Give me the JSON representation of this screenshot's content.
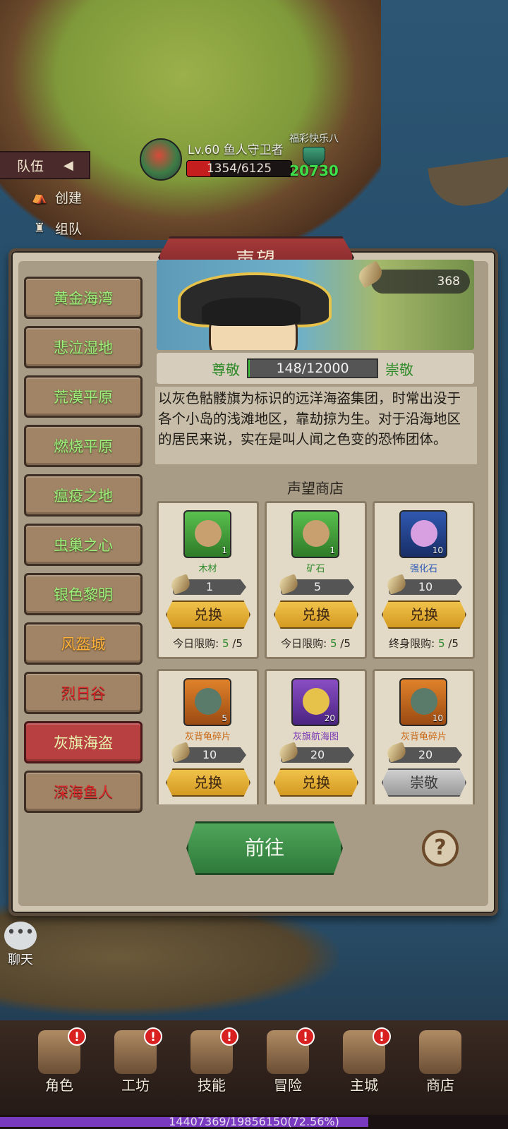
{
  "hud": {
    "team_tab": "队伍",
    "create_label": "创建",
    "group_label": "组队"
  },
  "boss": {
    "name": "Lv.60 鱼人守卫者",
    "hp_text": "1354/6125",
    "hp_fraction": 0.221
  },
  "guild": {
    "name": "福彩快乐八",
    "power": "20730"
  },
  "panel": {
    "title": "声望",
    "reputation_points": "368",
    "rep_current_level": "尊敬",
    "rep_next_level": "崇敬",
    "rep_progress_text": "148/12000",
    "rep_progress_fraction": 0.0123,
    "description": "以灰色骷髅旗为标识的远洋海盗集团，时常出没于各个小岛的浅滩地区，靠劫掠为生。对于沿海地区的居民来说，实在是叫人闻之色变的恐怖团体。",
    "shop_title": "声望商店",
    "go_label": "前往",
    "help_label": "?"
  },
  "regions": [
    {
      "label": "黄金海湾",
      "color": "green"
    },
    {
      "label": "悲泣湿地",
      "color": "green"
    },
    {
      "label": "荒漠平原",
      "color": "green"
    },
    {
      "label": "燃烧平原",
      "color": "green"
    },
    {
      "label": "瘟疫之地",
      "color": "green"
    },
    {
      "label": "虫巢之心",
      "color": "green"
    },
    {
      "label": "银色黎明",
      "color": "green"
    },
    {
      "label": "风盔城",
      "color": "orange"
    },
    {
      "label": "烈日谷",
      "color": "red"
    },
    {
      "label": "灰旗海盗",
      "color": "selected"
    },
    {
      "label": "深海鱼人",
      "color": "red"
    }
  ],
  "shop_items": [
    {
      "name": "木材",
      "qty": "1",
      "cost": "1",
      "button": "兑换",
      "limit_label": "今日限购:",
      "limit_used": "5",
      "limit_total": "/5",
      "rarity": "green",
      "button_style": "gold",
      "icon": "wood-icon"
    },
    {
      "name": "矿石",
      "qty": "1",
      "cost": "5",
      "button": "兑换",
      "limit_label": "今日限购:",
      "limit_used": "5",
      "limit_total": "/5",
      "rarity": "green",
      "button_style": "gold",
      "icon": "ore-icon"
    },
    {
      "name": "强化石",
      "qty": "10",
      "cost": "10",
      "button": "兑换",
      "limit_label": "终身限购:",
      "limit_used": "5",
      "limit_total": "/5",
      "rarity": "blue",
      "button_style": "gold",
      "icon": "enhance-stone-icon"
    },
    {
      "name": "灰背龟碎片",
      "qty": "5",
      "cost": "10",
      "button": "兑换",
      "limit_label": "",
      "limit_used": "",
      "limit_total": "",
      "rarity": "orange",
      "button_style": "gold",
      "icon": "turtle-fragment-icon"
    },
    {
      "name": "灰旗航海图",
      "qty": "20",
      "cost": "20",
      "button": "兑换",
      "limit_label": "",
      "limit_used": "",
      "limit_total": "",
      "rarity": "purple",
      "button_style": "gold",
      "icon": "sea-chart-icon"
    },
    {
      "name": "灰背龟碎片",
      "qty": "10",
      "cost": "20",
      "button": "崇敬",
      "limit_label": "",
      "limit_used": "",
      "limit_total": "",
      "rarity": "orange",
      "button_style": "grey",
      "icon": "turtle-fragment-icon"
    }
  ],
  "chat": {
    "label": "聊天"
  },
  "bottom_nav": [
    {
      "label": "角色",
      "badge": "!",
      "icon": "character-icon"
    },
    {
      "label": "工坊",
      "badge": "!",
      "icon": "workshop-icon"
    },
    {
      "label": "技能",
      "badge": "!",
      "icon": "skills-icon"
    },
    {
      "label": "冒险",
      "badge": "!",
      "icon": "adventure-icon"
    },
    {
      "label": "主城",
      "badge": "!",
      "icon": "main-city-icon"
    },
    {
      "label": "商店",
      "badge": "",
      "icon": "shop-icon"
    }
  ],
  "exp": {
    "text": "14407369/19856150(72.56%)",
    "fraction": 0.7256
  }
}
